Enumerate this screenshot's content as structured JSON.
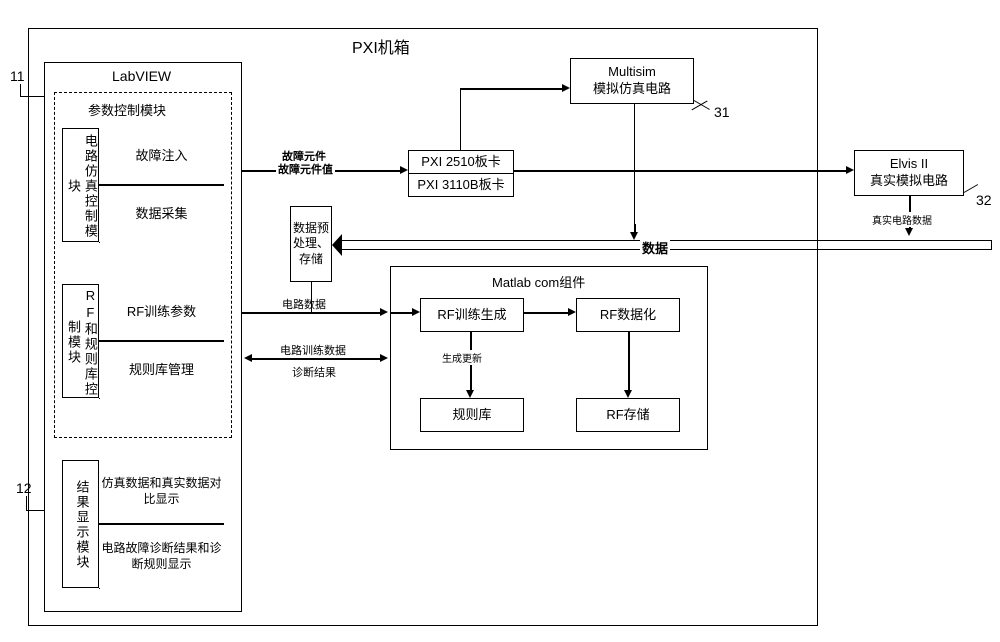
{
  "title": "PXI机箱",
  "labview": {
    "title": "LabVIEW",
    "param_module": "参数控制模块",
    "circuit_sim_control": "电路仿真控制模块",
    "fault_injection": "故障注入",
    "data_acquisition": "数据采集",
    "rf_rule_control": "RF和规则库控制模块",
    "rf_train_params": "RF训练参数",
    "rule_lib_mgmt": "规则库管理",
    "result_display": "结果显示模块",
    "sim_real_compare": "仿真数据和真实数据对比显示",
    "fault_diag_result": "电路故障诊断结果和诊断规则显示"
  },
  "multisim": {
    "title": "Multisim",
    "subtitle": "模拟仿真电路"
  },
  "elvis": {
    "title": "Elvis II",
    "subtitle": "真实模拟电路"
  },
  "pxi_cards": {
    "card1": "PXI 2510板卡",
    "card2": "PXI 3110B板卡"
  },
  "data_preprocess": "数据预处理、存储",
  "matlab": {
    "title": "Matlab com组件",
    "rf_train_gen": "RF训练生成",
    "rf_digitize": "RF数据化",
    "rule_lib": "规则库",
    "rf_store": "RF存储",
    "gen_update": "生成更新"
  },
  "arrows": {
    "fault_component": "故障元件",
    "fault_value": "故障元件值",
    "data": "数据",
    "real_circuit_data": "真实电路数据",
    "circuit_data": "电路数据",
    "circuit_train_data": "电路训练数据",
    "diag_result": "诊断结果"
  },
  "refs": {
    "r11": "11",
    "r12": "12",
    "r31": "31",
    "r32": "32"
  }
}
